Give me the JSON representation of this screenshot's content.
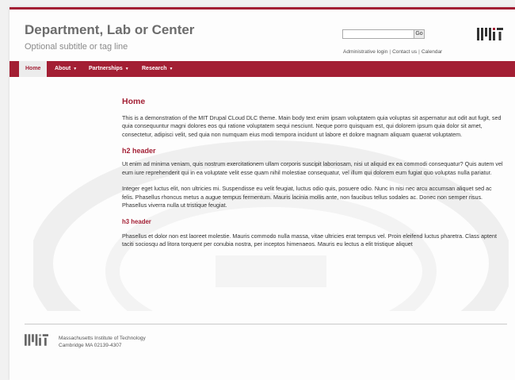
{
  "header": {
    "title": "Department, Lab or Center",
    "subtitle": "Optional subtitle or tag line",
    "search": {
      "placeholder": "",
      "button_label": "Go"
    },
    "util_links": [
      "Administrative login",
      "Contact us",
      "Calendar"
    ],
    "logo": "MIT"
  },
  "nav": [
    {
      "label": "Home",
      "active": true,
      "has_dropdown": false
    },
    {
      "label": "About",
      "active": false,
      "has_dropdown": true
    },
    {
      "label": "Partnerships",
      "active": false,
      "has_dropdown": true
    },
    {
      "label": "Research",
      "active": false,
      "has_dropdown": true
    }
  ],
  "main": {
    "h1": "Home",
    "p1": "This is a demonstration of the MIT Drupal CLoud DLC theme. Main body text enim ipsam voluptatem quia voluptas sit aspernatur aut odit aut fugit, sed quia consequuntur magni dolores eos qui ratione voluptatem sequi nesciunt. Neque porro quisquam est, qui dolorem ipsum quia dolor sit amet, consectetur, adipisci velit, sed quia non numquam eius modi tempora incidunt ut labore et dolore magnam aliquam quaerat voluptatem.",
    "h2": "h2 header",
    "p2": "Ut enim ad minima veniam, quis nostrum exercitationem ullam corporis suscipit laboriosam, nisi ut aliquid ex ea commodi consequatur? Quis autem vel eum iure reprehenderit qui in ea voluptate velit esse quam nihil molestiae consequatur, vel illum qui dolorem eum fugiat quo voluptas nulla pariatur.",
    "p3": "Integer eget luctus elit, non ultricies mi. Suspendisse eu velit feugiat, luctus odio quis, posuere odio. Nunc in nisi nec arcu accumsan aliquet sed ac felis. Phasellus rhoncus metus a augue tempus fermentum. Mauris lacinia mollis ante, non faucibus tellus sodales ac. Donec non semper risus. Phasellus viverra nulla ut tristique feugiat.",
    "h3": "h3 header",
    "p4": "Phasellus et dolor non est laoreet molestie. Mauris commodo nulla massa, vitae ultricies erat tempus vel. Proin eleifend luctus pharetra. Class aptent taciti sociosqu ad litora torquent per conubia nostra, per inceptos himenaeos. Mauris eu lectus a elit tristique aliquet"
  },
  "footer": {
    "logo": "MIT",
    "line1": "Massachusetts Institute of Technology",
    "line2": "Cambridge MA 02139-4307"
  },
  "colors": {
    "accent": "#a31f34",
    "nav_active_bg": "#ececec",
    "title": "#6c6c6c"
  }
}
